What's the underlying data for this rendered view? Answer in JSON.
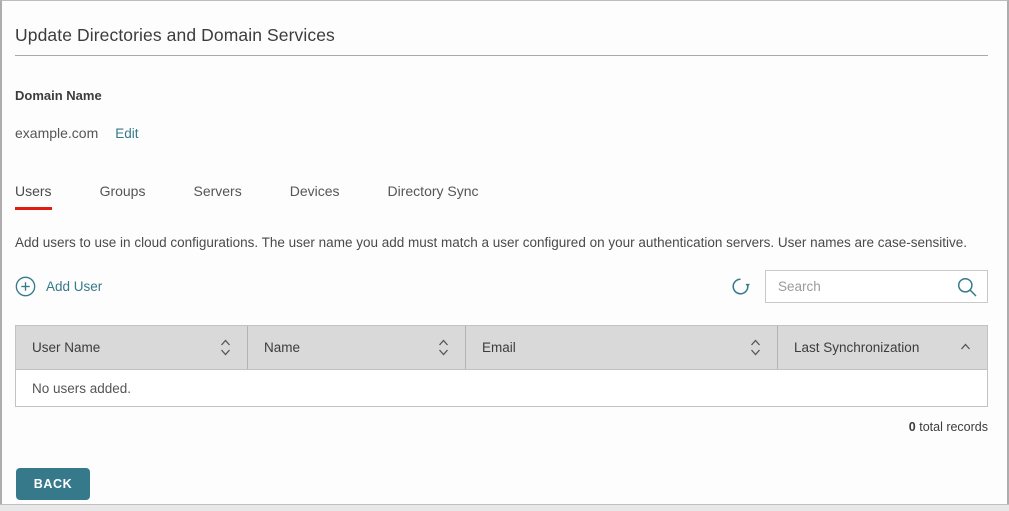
{
  "page": {
    "title": "Update Directories and Domain Services"
  },
  "domain": {
    "label": "Domain Name",
    "value": "example.com",
    "edit_label": "Edit"
  },
  "tabs": [
    {
      "label": "Users",
      "active": true
    },
    {
      "label": "Groups",
      "active": false
    },
    {
      "label": "Servers",
      "active": false
    },
    {
      "label": "Devices",
      "active": false
    },
    {
      "label": "Directory Sync",
      "active": false
    }
  ],
  "description": "Add users to use in cloud configurations. The user name you add must match a user configured on your authentication servers. User names are case-sensitive.",
  "toolbar": {
    "add_user_label": "Add User",
    "add_user_icon": "plus-circle-icon",
    "refresh_icon": "refresh-icon",
    "search_icon": "search-icon",
    "search_placeholder": "Search",
    "search_value": ""
  },
  "table": {
    "columns": [
      {
        "label": "User Name",
        "sort": "none"
      },
      {
        "label": "Name",
        "sort": "none"
      },
      {
        "label": "Email",
        "sort": "none"
      },
      {
        "label": "Last Synchronization",
        "sort": "asc"
      }
    ],
    "empty_message": "No users added.",
    "records_count": "0",
    "records_label": "total records"
  },
  "footer": {
    "back_label": "BACK"
  },
  "colors": {
    "accent_teal": "#35798B",
    "active_tab_red": "#E11E0E",
    "header_gray": "#D9D9D9"
  }
}
